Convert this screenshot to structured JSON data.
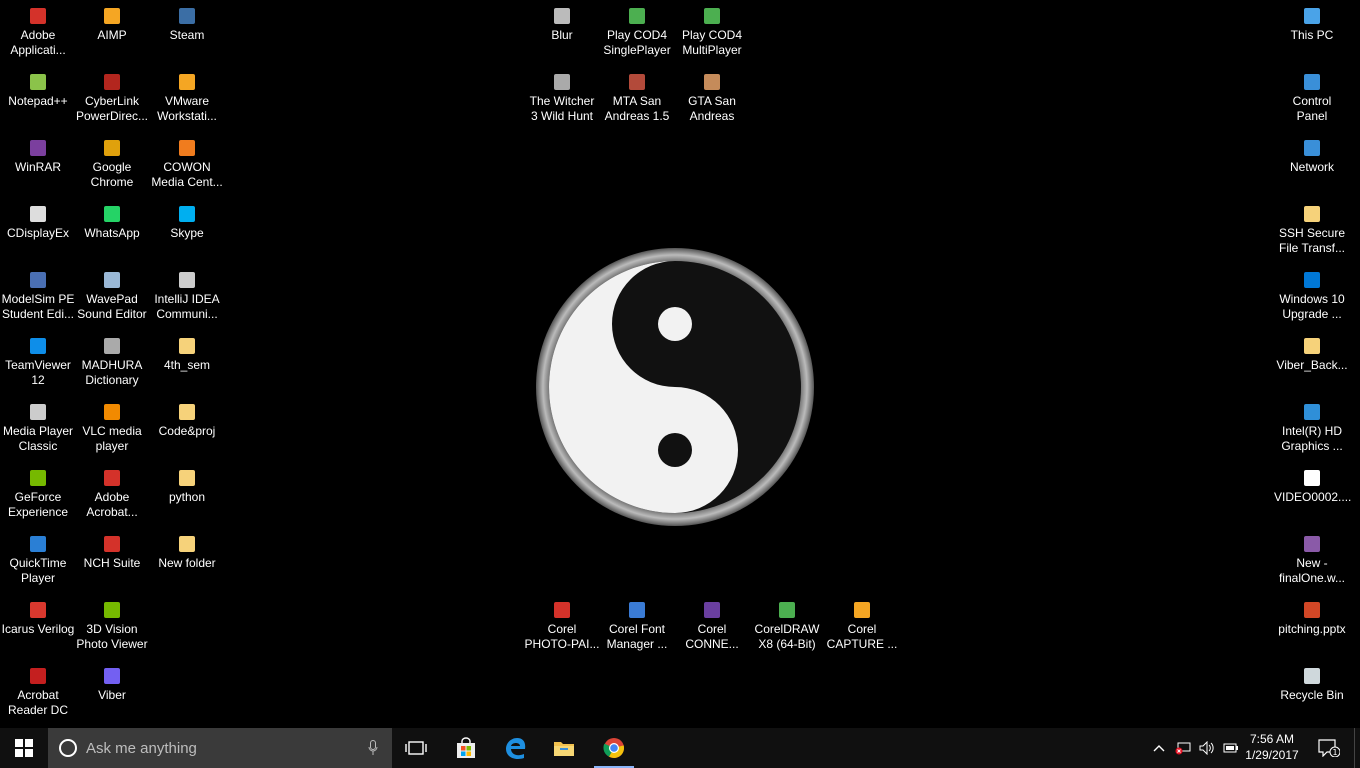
{
  "desktop": {
    "col1": [
      {
        "label": "Adobe\nApplicati...",
        "icon": "adobe-icon",
        "color": "#d4322a"
      },
      {
        "label": "Notepad++",
        "icon": "notepad-icon",
        "color": "#8bc34a"
      },
      {
        "label": "WinRAR",
        "icon": "winrar-icon",
        "color": "#7b3f9e"
      },
      {
        "label": "CDisplayEx",
        "icon": "cdisplay-icon",
        "color": "#dddddd"
      },
      {
        "label": "ModelSim PE\nStudent Edi...",
        "icon": "modelsim-icon",
        "color": "#4a6fb3"
      },
      {
        "label": "TeamViewer\n12",
        "icon": "teamviewer-icon",
        "color": "#0e8ee9"
      },
      {
        "label": "Media Player\nClassic",
        "icon": "mpc-icon",
        "color": "#cccccc"
      },
      {
        "label": "GeForce\nExperience",
        "icon": "geforce-icon",
        "color": "#76b900"
      },
      {
        "label": "QuickTime\nPlayer",
        "icon": "quicktime-icon",
        "color": "#2a7fd5"
      },
      {
        "label": "Icarus Verilog",
        "icon": "icarus-icon",
        "color": "#d9382e"
      },
      {
        "label": "Acrobat\nReader DC",
        "icon": "acrobat-reader-icon",
        "color": "#c41f1f"
      }
    ],
    "col2": [
      {
        "label": "AIMP",
        "icon": "aimp-icon",
        "color": "#f5a623"
      },
      {
        "label": "CyberLink\nPowerDirec...",
        "icon": "powerdirector-icon",
        "color": "#b3261e"
      },
      {
        "label": "Google\nChrome",
        "icon": "chrome-icon",
        "color": "#e0a10c"
      },
      {
        "label": "WhatsApp",
        "icon": "whatsapp-icon",
        "color": "#25d366"
      },
      {
        "label": "WavePad\nSound Editor",
        "icon": "wavepad-icon",
        "color": "#9ab8d6"
      },
      {
        "label": "MADHURA\nDictionary",
        "icon": "dictionary-icon",
        "color": "#aaaaaa"
      },
      {
        "label": "VLC media\nplayer",
        "icon": "vlc-icon",
        "color": "#f28a00"
      },
      {
        "label": "Adobe\nAcrobat...",
        "icon": "acrobat-icon",
        "color": "#d4322a"
      },
      {
        "label": "NCH Suite",
        "icon": "nch-icon",
        "color": "#d4322a"
      },
      {
        "label": "3D Vision\nPhoto Viewer",
        "icon": "3dvision-icon",
        "color": "#76b900"
      },
      {
        "label": "Viber",
        "icon": "viber-icon",
        "color": "#7360f2"
      }
    ],
    "col3": [
      {
        "label": "Steam",
        "icon": "steam-icon",
        "color": "#3b6ea5"
      },
      {
        "label": "VMware\nWorkstati...",
        "icon": "vmware-icon",
        "color": "#f5a623"
      },
      {
        "label": "COWON\nMedia Cent...",
        "icon": "cowon-icon",
        "color": "#f07c1e"
      },
      {
        "label": "Skype",
        "icon": "skype-icon",
        "color": "#00aff0"
      },
      {
        "label": "IntelliJ IDEA\nCommuni...",
        "icon": "intellij-icon",
        "color": "#cccccc"
      },
      {
        "label": "4th_sem",
        "icon": "folder-icon",
        "color": "#f6d27a"
      },
      {
        "label": "Code&proj",
        "icon": "folder-icon",
        "color": "#f6d27a"
      },
      {
        "label": "python",
        "icon": "folder-icon",
        "color": "#f6d27a"
      },
      {
        "label": "New folder",
        "icon": "folder-icon",
        "color": "#f6d27a"
      }
    ],
    "games_row1": [
      {
        "label": "Blur",
        "icon": "blur-icon",
        "color": "#bbbbbb"
      },
      {
        "label": "Play COD4\nSinglePlayer",
        "icon": "cod4-icon",
        "color": "#4caf50"
      },
      {
        "label": "Play COD4\nMultiPlayer",
        "icon": "cod4-icon",
        "color": "#4caf50"
      }
    ],
    "games_row2": [
      {
        "label": "The Witcher\n3 Wild Hunt",
        "icon": "witcher-icon",
        "color": "#aaaaaa"
      },
      {
        "label": "MTA San\nAndreas 1.5",
        "icon": "mta-icon",
        "color": "#b34a3a"
      },
      {
        "label": "GTA San\nAndreas",
        "icon": "gta-icon",
        "color": "#c58b5a"
      }
    ],
    "corel_row": [
      {
        "label": "Corel\nPHOTO-PAI...",
        "icon": "corel-photopaint-icon",
        "color": "#d4322a"
      },
      {
        "label": "Corel Font\nManager ...",
        "icon": "corel-font-icon",
        "color": "#3a7bd5"
      },
      {
        "label": "Corel\nCONNE...",
        "icon": "corel-connect-icon",
        "color": "#6a3fa0"
      },
      {
        "label": "CorelDRAW\nX8 (64-Bit)",
        "icon": "coreldraw-icon",
        "color": "#4caf50"
      },
      {
        "label": "Corel\nCAPTURE ...",
        "icon": "corel-capture-icon",
        "color": "#f5a623"
      }
    ],
    "right_col": [
      {
        "label": "This PC",
        "icon": "this-pc-icon",
        "color": "#4aa3e8"
      },
      {
        "label": "Control\nPanel",
        "icon": "control-panel-icon",
        "color": "#3a8fd8"
      },
      {
        "label": "Network",
        "icon": "network-icon",
        "color": "#3a8fd8"
      },
      {
        "label": "SSH Secure\nFile Transf...",
        "icon": "ssh-icon",
        "color": "#f6d27a"
      },
      {
        "label": "Windows 10\nUpgrade ...",
        "icon": "windows-upgrade-icon",
        "color": "#0078d7"
      },
      {
        "label": "Viber_Back...",
        "icon": "file-icon",
        "color": "#f6d27a"
      },
      {
        "label": "Intel(R) HD\nGraphics ...",
        "icon": "intel-icon",
        "color": "#2f8fd8"
      },
      {
        "label": "VIDEO0002....",
        "icon": "video-file-icon",
        "color": "#ffffff"
      },
      {
        "label": "New -\nfinalOne.w...",
        "icon": "audio-file-icon",
        "color": "#8a5aa8"
      },
      {
        "label": "pitching.pptx",
        "icon": "pptx-icon",
        "color": "#d24726"
      },
      {
        "label": "Recycle Bin",
        "icon": "recycle-bin-icon",
        "color": "#cfd8dc"
      }
    ]
  },
  "taskbar": {
    "search_placeholder": "Ask me anything",
    "time": "7:56 AM",
    "date": "1/29/2017",
    "notification_count": "1"
  }
}
